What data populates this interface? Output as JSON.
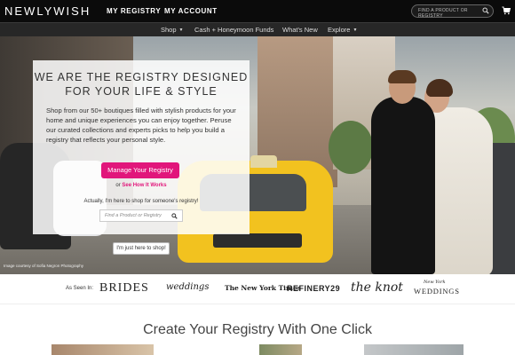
{
  "header": {
    "logo": "NEWLYWISH",
    "nav": [
      "MY REGISTRY",
      "MY ACCOUNT"
    ],
    "search_placeholder": "FIND A PRODUCT OR REGISTRY"
  },
  "subnav": {
    "items": [
      {
        "label": "Shop",
        "dropdown": true
      },
      {
        "label": "Cash + Honeymoon Funds",
        "dropdown": false
      },
      {
        "label": "What's New",
        "dropdown": false
      },
      {
        "label": "Explore",
        "dropdown": true
      }
    ]
  },
  "hero": {
    "title_line1": "WE ARE THE REGISTRY DESIGNED",
    "title_line2": "FOR YOUR LIFE & STYLE",
    "body": "Shop from our 50+ boutiques filled with stylish products for your home and unique experiences you can enjoy together. Peruse our curated collections and experts picks to help you build a registry that reflects your personal style.",
    "cta_label": "Manage Your Registry",
    "or_text": "or",
    "how_it_works": "See How It Works",
    "shop_for_text": "Actually, I'm here to shop for someone's registry!",
    "search_placeholder": "Find a Product or Registry",
    "shop_button": "I'm just here to shop!",
    "credit": "Image courtesy of Sofia Negron Photography"
  },
  "press": {
    "label": "As Seen In:",
    "logos": [
      "BRIDES",
      "weddings",
      "The New York Times",
      "REFINERY29",
      "the knot",
      "New York",
      "WEDDINGS"
    ]
  },
  "section": {
    "headline": "Create Your Registry With One Click"
  }
}
